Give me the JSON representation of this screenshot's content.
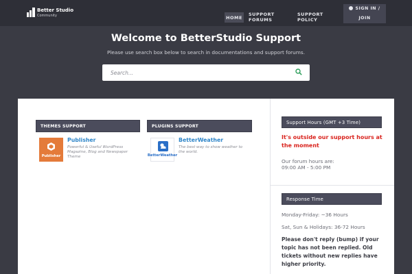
{
  "logo": {
    "line1": "Better Studio",
    "line2": "Community"
  },
  "nav": {
    "home": "HOME",
    "forums": "SUPPORT FORUMS",
    "policy": "SUPPORT POLICY"
  },
  "signin": {
    "line1": "SIGN IN /",
    "line2": "JOIN"
  },
  "hero": {
    "title": "Welcome to BetterStudio Support",
    "subtitle": "Please use search box below to search in documentations and support forums.",
    "search_placeholder": "Search..."
  },
  "themes": {
    "heading": "THEMES SUPPORT",
    "item": {
      "thumb_label": "Publisher",
      "title": "Publisher",
      "description": "Powerful & Useful WordPress Magazine, Blog and Newspaper Theme",
      "thumb_color": "#e47b3a"
    }
  },
  "plugins": {
    "heading": "PLUGINS SUPPORT",
    "item": {
      "thumb_label": "BetterWeather",
      "title": "BetterWeather",
      "description": "The best way to show weather to the world.",
      "thumb_color": "#2a6fc7"
    }
  },
  "sidebar": {
    "hours_heading": "Support Hours (GMT +3 Time)",
    "outside_notice": "It's outside our support hours at the moment",
    "forum_hours_label": "Our forum hours are:",
    "forum_hours_value": "09:00 AM - 5:00 PM",
    "response_heading": "Response Time",
    "weekday": "Monday-Friday: ~36 Hours",
    "weekend": "Sat, Sun & Holidays: 36-72 Hours",
    "note": "Please don't reply (bump) if your topic has not been replied. Old tickets without new replies have higher priority."
  },
  "colors": {
    "accent_link": "#2f86c9",
    "alert_red": "#d9231d",
    "header_dark": "#2e2f37"
  }
}
